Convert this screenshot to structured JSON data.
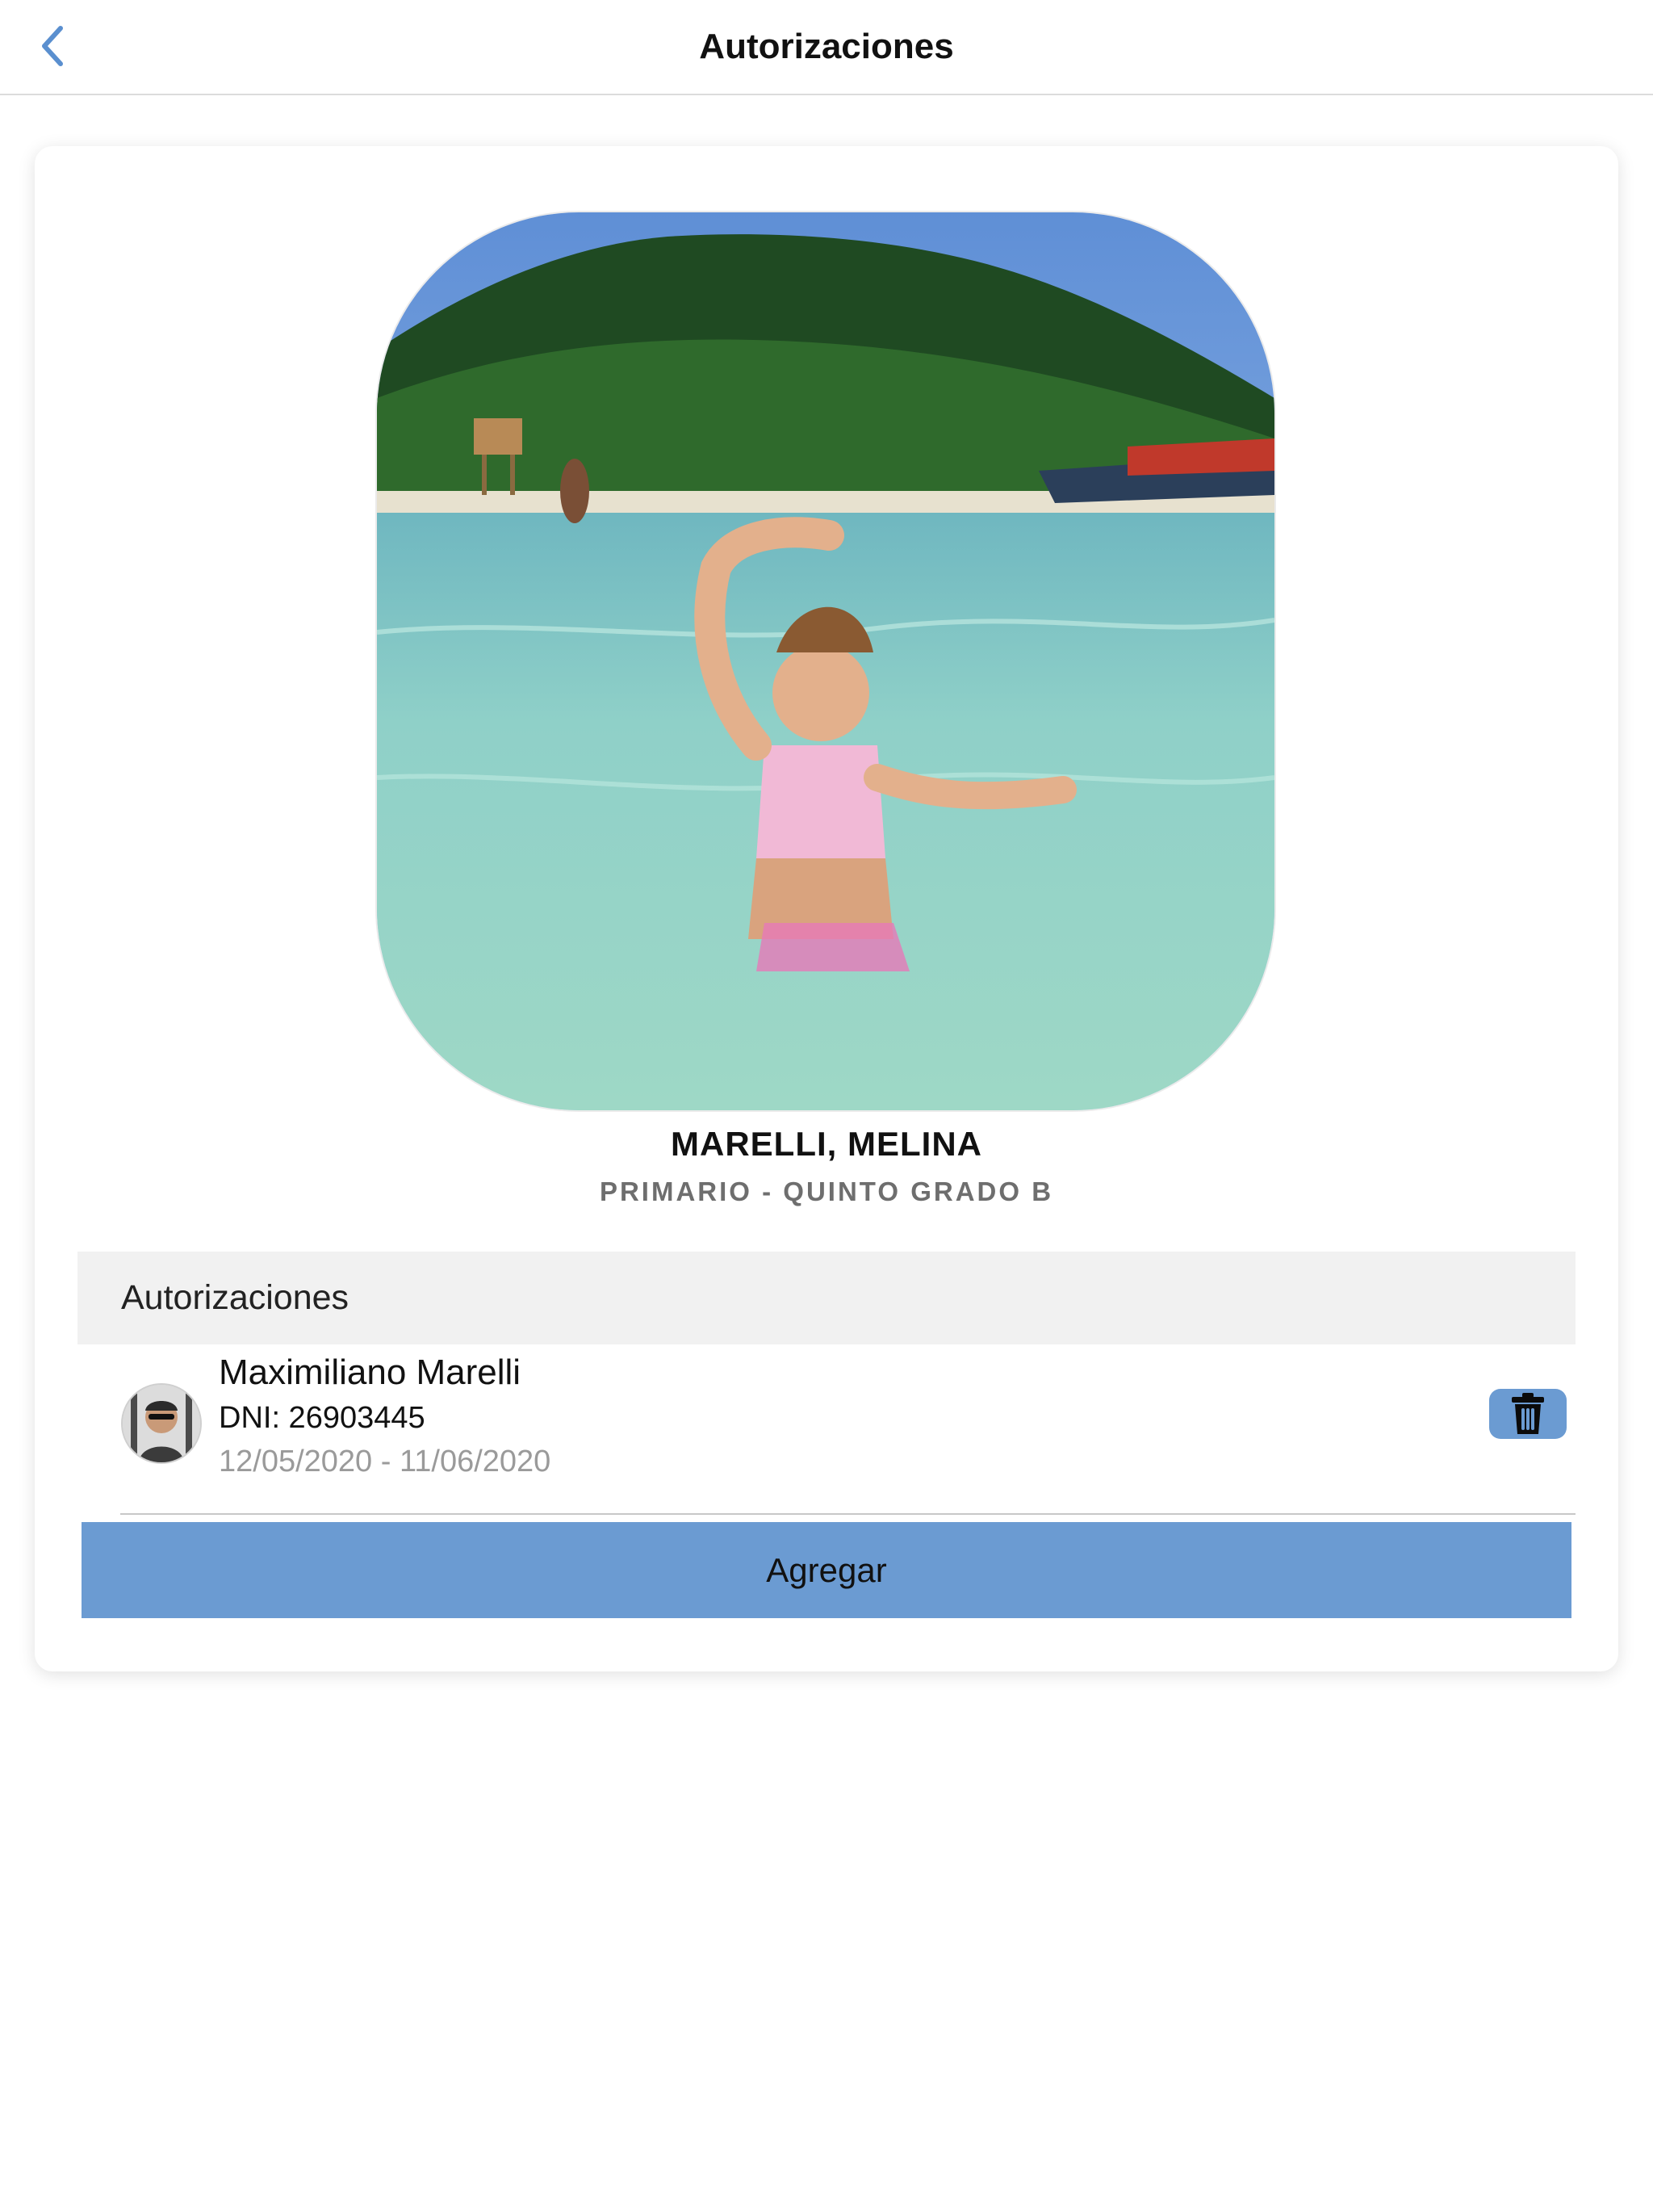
{
  "navbar": {
    "title": "Autorizaciones",
    "back_icon": "chevron-left-icon"
  },
  "student": {
    "photo": "student-photo-beach",
    "name": "MARELLI, MELINA",
    "level": "PRIMARIO - QUINTO GRADO B"
  },
  "authorizations": {
    "section_title": "Autorizaciones",
    "items": [
      {
        "avatar": "person-avatar",
        "name": "Maximiliano Marelli",
        "dni": "DNI: 26903445",
        "dates": "12/05/2020 - 11/06/2020",
        "delete_icon": "trash-icon"
      }
    ]
  },
  "actions": {
    "add_label": "Agregar"
  },
  "colors": {
    "accent": "#6b9bd2",
    "back_chevron": "#5a8fcf",
    "section_header_bg": "#f1f1f1",
    "secondary_text": "#9a9a9a"
  }
}
